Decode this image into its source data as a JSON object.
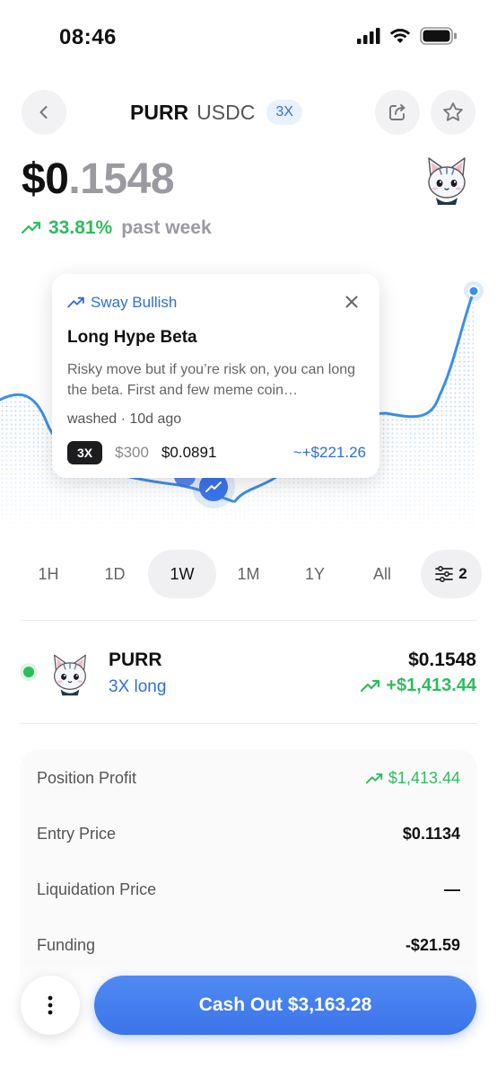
{
  "status_bar": {
    "time": "08:46",
    "icons": [
      "signal-icon",
      "wifi-icon",
      "battery-icon"
    ]
  },
  "header": {
    "base": "PURR",
    "quote": "USDC",
    "leverage": "3X",
    "back_icon": "chevron-left-icon",
    "share_icon": "share-icon",
    "favorite_icon": "star-icon"
  },
  "price": {
    "main": "$0",
    "fraction": ".1548"
  },
  "change": {
    "percent": "33.81%",
    "period": "past week",
    "icon": "trend-up-icon"
  },
  "popup": {
    "tag": "Sway Bullish",
    "title": "Long Hype Beta",
    "body": "Risky move but if you’re risk on, you can long the beta. First and few meme coin…",
    "meta": "washed · 10d ago",
    "leverage": "3X",
    "amount": "$300",
    "entry": "$0.0891",
    "pnl": "~+$221.26"
  },
  "tabs": {
    "items": [
      "1H",
      "1D",
      "1W",
      "1M",
      "1Y",
      "All"
    ],
    "active": "1W",
    "filter_count": "2"
  },
  "position": {
    "name": "PURR",
    "type": "3X long",
    "price": "$0.1548",
    "pnl": "+$1,413.44"
  },
  "details": [
    {
      "label": "Position Profit",
      "value": "$1,413.44"
    },
    {
      "label": "Entry Price",
      "value": "$0.1134"
    },
    {
      "label": "Liquidation Price",
      "value": "—"
    },
    {
      "label": "Funding",
      "value": "-$21.59"
    }
  ],
  "cashout": {
    "label": "Cash Out $3,163.28"
  },
  "colors": {
    "accent": "#3b74ea",
    "positive": "#2dbd5c",
    "text": "#111111",
    "muted": "#9a9aa0"
  }
}
